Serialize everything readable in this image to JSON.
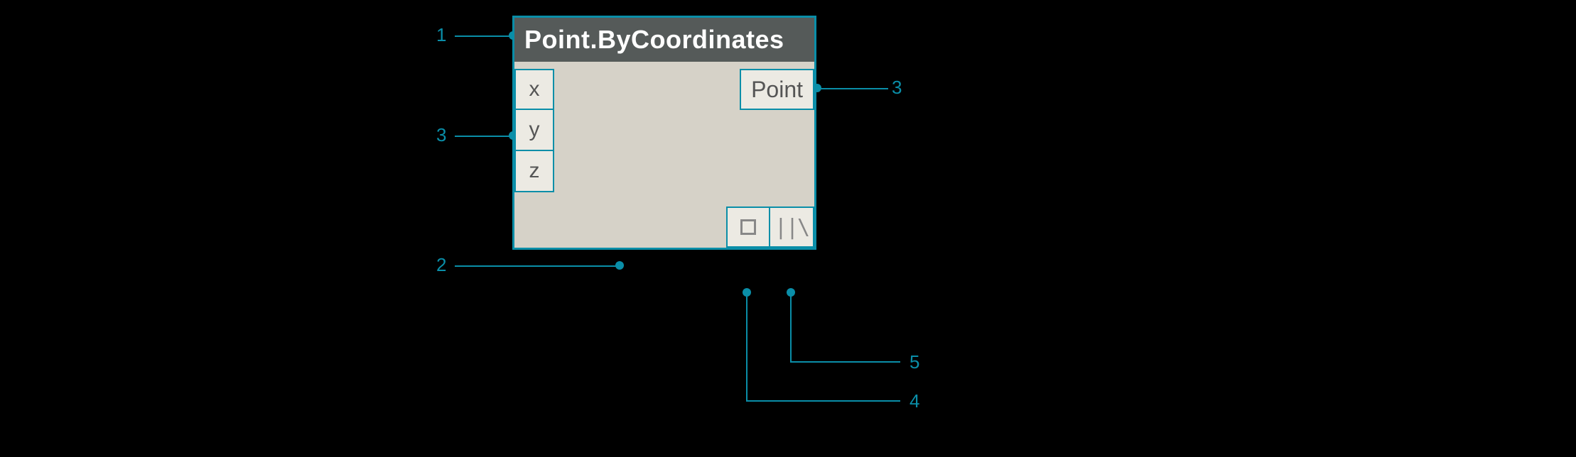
{
  "node": {
    "title": "Point.ByCoordinates",
    "inputs": [
      "x",
      "y",
      "z"
    ],
    "output": "Point",
    "lacing_glyph": "||\\"
  },
  "annotations": {
    "a1": "1",
    "a2": "2",
    "a3_left": "3",
    "a3_right": "3",
    "a4": "4",
    "a5": "5"
  }
}
